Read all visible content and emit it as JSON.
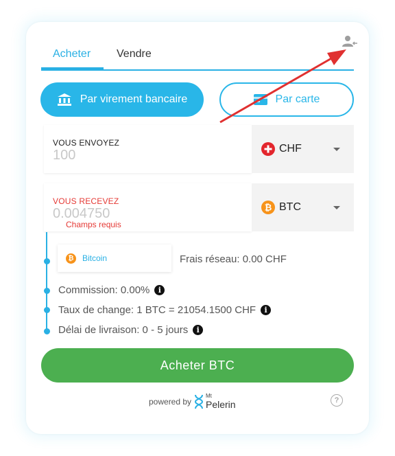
{
  "tabs": {
    "buy": "Acheter",
    "sell": "Vendre"
  },
  "methods": {
    "bank": "Par virement bancaire",
    "card": "Par carte"
  },
  "send": {
    "label": "VOUS ENVOYEZ",
    "value": "100",
    "currency": "CHF"
  },
  "receive": {
    "label": "VOUS RECEVEZ",
    "value": "0.004750",
    "currency": "BTC",
    "error": "Champs requis"
  },
  "network": {
    "name": "Bitcoin",
    "fee": "Frais réseau: 0.00 CHF"
  },
  "details": {
    "commission": "Commission: 0.00%",
    "rate": "Taux de change: 1 BTC = 21054.1500 CHF",
    "delivery": "Délai de livraison: 0 - 5 jours"
  },
  "cta": "Acheter BTC",
  "footer": {
    "powered_by": "powered by",
    "brand_small": "Mt",
    "brand": "Pelerin"
  },
  "colors": {
    "accent": "#29b6e8",
    "cta": "#4caf50",
    "error": "#e53935",
    "btc": "#f7931a",
    "swiss": "#e3262d"
  },
  "icons": [
    "user-icon",
    "bank-icon",
    "card-icon",
    "swiss-flag-icon",
    "bitcoin-icon",
    "info-icon",
    "help-icon",
    "pelerin-logo-icon"
  ]
}
